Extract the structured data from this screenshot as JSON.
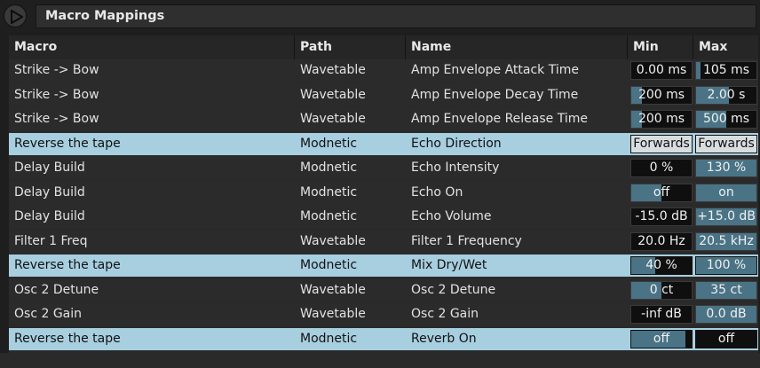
{
  "window": {
    "title": "Macro Mappings"
  },
  "columns": [
    "Macro",
    "Path",
    "Name",
    "Min",
    "Max"
  ],
  "rows": [
    {
      "macro": "Strike -> Bow",
      "path": "Wavetable",
      "name": "Amp Envelope Attack Time",
      "min": "0.00 ms",
      "max": "105 ms",
      "min_fill": 0.0,
      "max_fill": 0.08,
      "selected": false
    },
    {
      "macro": "Strike -> Bow",
      "path": "Wavetable",
      "name": "Amp Envelope Decay Time",
      "min": "200 ms",
      "max": "2.00 s",
      "min_fill": 0.18,
      "max_fill": 0.55,
      "selected": false
    },
    {
      "macro": "Strike -> Bow",
      "path": "Wavetable",
      "name": "Amp Envelope Release Time",
      "min": "200 ms",
      "max": "500 ms",
      "min_fill": 0.18,
      "max_fill": 0.5,
      "selected": false
    },
    {
      "macro": "Reverse the tape",
      "path": "Modnetic",
      "name": "Echo Direction",
      "min": "Forwards",
      "max": "Forwards",
      "min_fill": 0.0,
      "max_fill": 0.0,
      "selected": true
    },
    {
      "macro": "Delay Build",
      "path": "Modnetic",
      "name": "Echo Intensity",
      "min": "0 %",
      "max": "130 %",
      "min_fill": 0.0,
      "max_fill": 1.0,
      "selected": false
    },
    {
      "macro": "Delay Build",
      "path": "Modnetic",
      "name": "Echo On",
      "min": "off",
      "max": "on",
      "min_fill": 0.5,
      "max_fill": 1.0,
      "selected": false
    },
    {
      "macro": "Delay Build",
      "path": "Modnetic",
      "name": "Echo Volume",
      "min": "-15.0 dB",
      "max": "+15.0 dB",
      "min_fill": 0.0,
      "max_fill": 1.0,
      "selected": false
    },
    {
      "macro": "Filter 1 Freq",
      "path": "Wavetable",
      "name": "Filter 1 Frequency",
      "min": "20.0 Hz",
      "max": "20.5 kHz",
      "min_fill": 0.0,
      "max_fill": 1.0,
      "selected": false
    },
    {
      "macro": "Reverse the tape",
      "path": "Modnetic",
      "name": "Mix Dry/Wet",
      "min": "40 %",
      "max": "100 %",
      "min_fill": 0.4,
      "max_fill": 1.0,
      "selected": true
    },
    {
      "macro": "Osc 2 Detune",
      "path": "Wavetable",
      "name": "Osc 2 Detune",
      "min": "0 ct",
      "max": "35 ct",
      "min_fill": 0.5,
      "max_fill": 1.0,
      "selected": false
    },
    {
      "macro": "Osc 2 Gain",
      "path": "Wavetable",
      "name": "Osc 2 Gain",
      "min": "-inf dB",
      "max": "0.0 dB",
      "min_fill": 0.0,
      "max_fill": 1.0,
      "selected": false
    },
    {
      "macro": "Reverse the tape",
      "path": "Modnetic",
      "name": "Reverb On",
      "min": "off",
      "max": "off",
      "min_fill": 0.9,
      "max_fill": 0.0,
      "selected": true
    }
  ],
  "colors": {
    "selected_row": "#a7cfe0",
    "fill": "#4a7386",
    "background": "#2b2b2b"
  }
}
